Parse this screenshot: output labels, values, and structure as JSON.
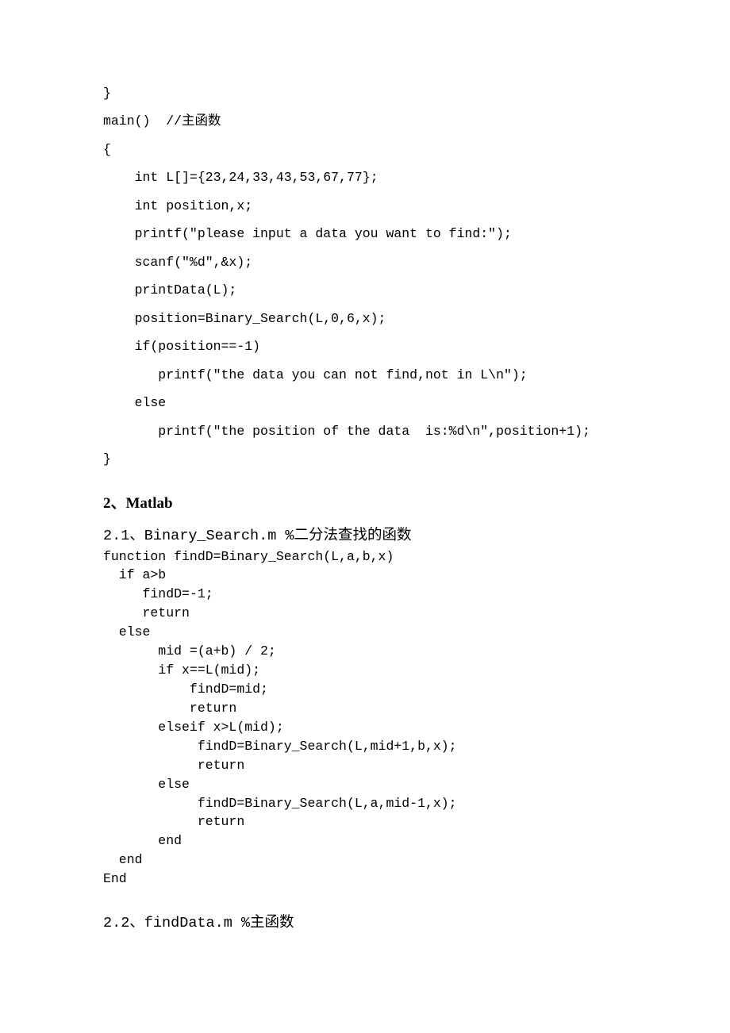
{
  "code_block_1": "}\nmain()  //主函数\n{\n    int L[]={23,24,33,43,53,67,77};\n    int position,x;\n    printf(\"please input a data you want to find:\");\n    scanf(\"%d\",&x);\n    printData(L);\n    position=Binary_Search(L,0,6,x);\n    if(position==-1)\n       printf(\"the data you can not find,not in L\\n\");\n    else\n       printf(\"the position of the data  is:%d\\n\",position+1);\n}",
  "heading_matlab": "2、Matlab",
  "heading_21": "2.1、Binary_Search.m %二分法查找的函数",
  "code_block_2": "function findD=Binary_Search(L,a,b,x)\n  if a>b\n     findD=-1;\n     return\n  else\n       mid =(a+b) / 2;\n       if x==L(mid);\n           findD=mid;\n           return\n       elseif x>L(mid);\n            findD=Binary_Search(L,mid+1,b,x);\n            return\n       else\n            findD=Binary_Search(L,a,mid-1,x);\n            return\n       end\n  end\nEnd",
  "heading_22": "2.2、findData.m  %主函数"
}
